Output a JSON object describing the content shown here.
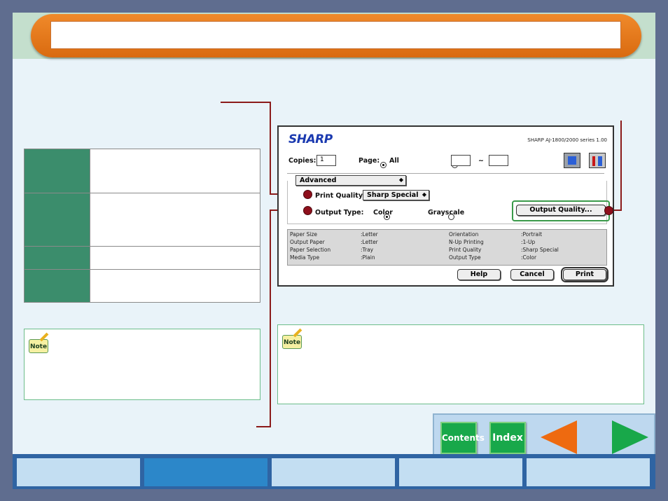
{
  "page": {
    "title": ""
  },
  "settings_table": [
    {
      "key": "",
      "value": ""
    },
    {
      "key": "",
      "value": ""
    },
    {
      "key": "",
      "value": ""
    },
    {
      "key": "",
      "value": ""
    }
  ],
  "notes": {
    "left_label": "Note",
    "right_label": "Note"
  },
  "dialog": {
    "brand": "SHARP",
    "version": "SHARP AJ-1800/2000 series 1.00",
    "copies_label": "Copies:",
    "copies_value": "1",
    "page_label": "Page:",
    "page_all_label": "All",
    "page_from": "",
    "page_range_sep": "~",
    "page_to": "",
    "tab_popup": "Advanced",
    "print_quality_label": "Print Quality:",
    "print_quality_value": "Sharp Special",
    "output_type_label": "Output Type:",
    "output_color_label": "Color",
    "output_grayscale_label": "Grayscale",
    "output_type_selected": "Color",
    "output_quality_button": "Output Quality...",
    "summary": [
      {
        "key": "Paper Size",
        "value": ":Letter",
        "key2": "Orientation",
        "value2": ":Portrait"
      },
      {
        "key": "Output Paper",
        "value": ":Letter",
        "key2": "N-Up Printing",
        "value2": ":1-Up"
      },
      {
        "key": "Paper Selection",
        "value": ":Tray",
        "key2": "Print Quality",
        "value2": ":Sharp Special"
      },
      {
        "key": "Media Type",
        "value": ":Plain",
        "key2": "Output Type",
        "value2": ":Color"
      }
    ],
    "help_button": "Help",
    "cancel_button": "Cancel",
    "print_button": "Print"
  },
  "nav": {
    "contents_label": "Contents",
    "index_label": "Index",
    "colors": {
      "green": "#18a84a",
      "orange": "#ee6a10",
      "accent": "#8e0f1c"
    }
  },
  "tabs": [
    {
      "label": ""
    },
    {
      "label": ""
    },
    {
      "label": ""
    },
    {
      "label": ""
    },
    {
      "label": ""
    }
  ]
}
